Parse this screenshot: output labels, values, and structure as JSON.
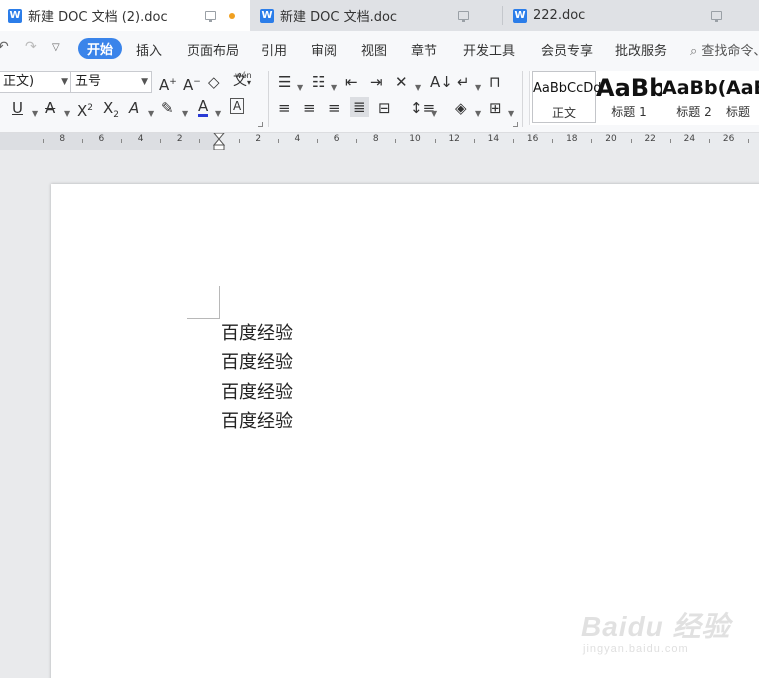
{
  "tabs": [
    {
      "title": "新建 DOC 文档 (2).doc",
      "active": true,
      "unsaved": true
    },
    {
      "title": "新建 DOC 文档.doc",
      "active": false
    },
    {
      "title": "222.doc",
      "active": false
    }
  ],
  "menu": {
    "items": [
      "开始",
      "插入",
      "页面布局",
      "引用",
      "审阅",
      "视图",
      "章节",
      "开发工具",
      "会员专享",
      "批改服务"
    ],
    "active": "开始",
    "search_placeholder": "查找命令、",
    "accent_color": "#3a84ea"
  },
  "ribbon": {
    "font_name": "正文)",
    "font_size": "五号",
    "pinyin_label": "wén",
    "styles": [
      {
        "sample": "AaBbCcDd",
        "name": "正文"
      },
      {
        "sample": "AaBb",
        "name": "标题 1"
      },
      {
        "sample": "AaBb(",
        "name": "标题 2"
      },
      {
        "sample": "AaB",
        "name": "标题"
      }
    ]
  },
  "ruler": {
    "labels": [
      "8",
      "6",
      "4",
      "2",
      "2",
      "4",
      "6",
      "8",
      "10",
      "12",
      "14",
      "16",
      "18",
      "20",
      "22",
      "24",
      "26"
    ]
  },
  "document": {
    "lines": [
      "百度经验",
      "百度经验",
      "百度经验",
      "百度经验"
    ]
  },
  "watermark": {
    "logo_text": "Baidu 经验",
    "url_text": "jingyan.baidu.com"
  }
}
